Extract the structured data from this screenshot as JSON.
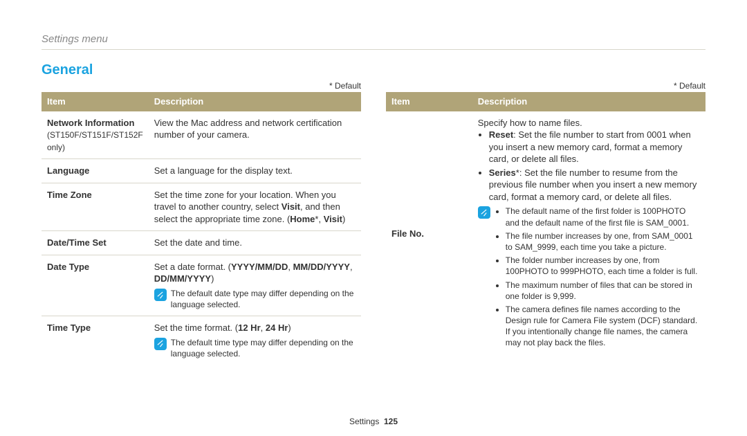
{
  "page": {
    "breadcrumb": "Settings menu",
    "section_title": "General",
    "default_note": "* Default",
    "footer_label": "Settings",
    "footer_page": "125"
  },
  "table_headers": {
    "item": "Item",
    "description": "Description"
  },
  "left_rows": [
    {
      "item": "Network Information",
      "item_sub": "(ST150F/ST151F/ST152F only)",
      "desc_plain": "View the Mac address and network certification number of your camera."
    },
    {
      "item": "Language",
      "desc_plain": "Set a language for the display text."
    },
    {
      "item": "Time Zone",
      "desc_html": "Set the time zone for your location. When you travel to another country, select <b>Visit</b>, and then select the appropriate time zone. (<b>Home</b>*, <b>Visit</b>)"
    },
    {
      "item": "Date/Time Set",
      "desc_plain": "Set the date and time."
    },
    {
      "item": "Date Type",
      "desc_html": "Set a date format. (<b>YYYY/MM/DD</b>, <b>MM/DD/YYYY</b>, <b>DD/MM/YYYY</b>)",
      "note": "The default date type may differ depending on the language selected."
    },
    {
      "item": "Time Type",
      "desc_html": "Set the time format. (<b>12 Hr</b>, <b>24 Hr</b>)",
      "note": "The default time type may differ depending on the language selected."
    }
  ],
  "right_row": {
    "item": "File No.",
    "intro": "Specify how to name files.",
    "bullets_top": [
      "<b>Reset</b>: Set the file number to start from 0001 when you insert a new memory card, format a memory card, or delete all files.",
      "<b>Series</b>*: Set the file number to resume from the previous file number when you insert a new memory card, format a memory card, or delete all files."
    ],
    "note_bullets": [
      "The default name of the first folder is 100PHOTO and the default name of the first file is SAM_0001.",
      "The file number increases by one, from SAM_0001 to SAM_9999, each time you take a picture.",
      "The folder number increases by one, from 100PHOTO to 999PHOTO, each time a folder is full.",
      "The maximum number of files that can be stored in one folder is 9,999.",
      "The camera defines file names according to the Design rule for Camera File system (DCF) standard. If you intentionally change file names, the camera may not play back the files."
    ]
  }
}
